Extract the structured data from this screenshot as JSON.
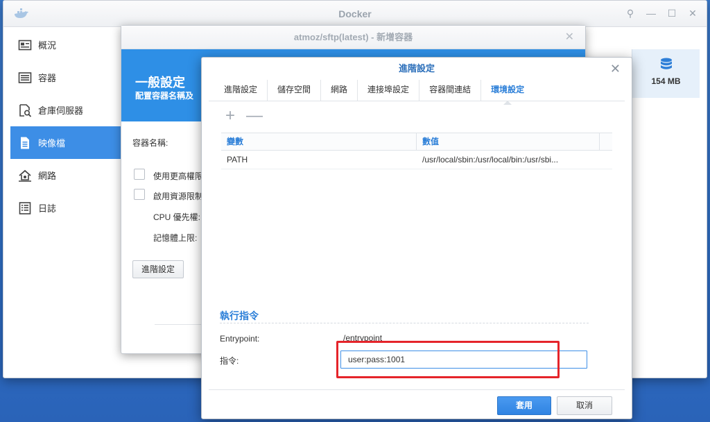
{
  "main_window": {
    "title": "Docker",
    "controls": {
      "pin": "⚲",
      "minimize": "—",
      "maximize": "☐",
      "close": "✕"
    },
    "sidebar": {
      "items": [
        {
          "label": "概況",
          "icon": "overview-card-icon"
        },
        {
          "label": "容器",
          "icon": "container-list-icon"
        },
        {
          "label": "倉庫伺服器",
          "icon": "registry-search-icon"
        },
        {
          "label": "映像檔",
          "icon": "image-document-icon",
          "active": true
        },
        {
          "label": "網路",
          "icon": "network-house-icon"
        },
        {
          "label": "日誌",
          "icon": "log-list-icon"
        }
      ]
    },
    "storage_card": {
      "size": "154 MB"
    }
  },
  "create_window": {
    "title": "atmoz/sftp(latest) - 新增容器",
    "banner_title": "一般設定",
    "banner_subtitle": "配置容器名稱及",
    "container_name_label": "容器名稱:",
    "privileged_label": "使用更高權限",
    "resource_limit_label": "啟用資源限制",
    "cpu_label": "CPU 優先權:",
    "memory_label": "記憶體上限:",
    "advanced_button": "進階設定"
  },
  "advanced_dialog": {
    "title": "進階設定",
    "tabs": [
      "進階設定",
      "儲存空間",
      "網路",
      "連接埠設定",
      "容器間連結",
      "環境設定"
    ],
    "active_tab": "環境設定",
    "toolbar": {
      "add": "+",
      "remove": "—"
    },
    "env_table": {
      "headers": {
        "variable": "變數",
        "value": "數值"
      },
      "rows": [
        {
          "variable": "PATH",
          "value": "/usr/local/sbin:/usr/local/bin:/usr/sbi..."
        }
      ]
    },
    "exec_section": {
      "title": "執行指令",
      "entrypoint_label": "Entrypoint:",
      "entrypoint_value": "/entrypoint",
      "command_label": "指令:",
      "command_value": "user:pass:1001"
    },
    "buttons": {
      "apply": "套用",
      "cancel": "取消"
    },
    "highlight_color": "#e5242a"
  }
}
